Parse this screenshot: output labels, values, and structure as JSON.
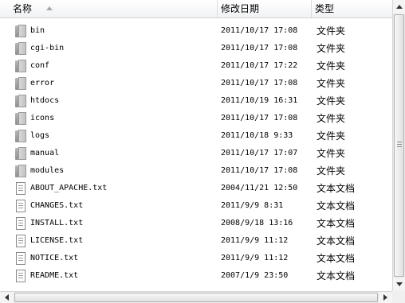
{
  "header": {
    "name_label": "名称",
    "date_label": "修改日期",
    "type_label": "类型"
  },
  "files": [
    {
      "name": "bin",
      "date": "2011/10/17 17:08",
      "type": "文件夹",
      "icon": "folder-icon"
    },
    {
      "name": "cgi-bin",
      "date": "2011/10/17 17:08",
      "type": "文件夹",
      "icon": "folder-icon"
    },
    {
      "name": "conf",
      "date": "2011/10/17 17:22",
      "type": "文件夹",
      "icon": "folder-icon"
    },
    {
      "name": "error",
      "date": "2011/10/17 17:08",
      "type": "文件夹",
      "icon": "folder-icon"
    },
    {
      "name": "htdocs",
      "date": "2011/10/19 16:31",
      "type": "文件夹",
      "icon": "folder-icon"
    },
    {
      "name": "icons",
      "date": "2011/10/17 17:08",
      "type": "文件夹",
      "icon": "folder-icon"
    },
    {
      "name": "logs",
      "date": "2011/10/18 9:33",
      "type": "文件夹",
      "icon": "folder-icon"
    },
    {
      "name": "manual",
      "date": "2011/10/17 17:07",
      "type": "文件夹",
      "icon": "folder-icon"
    },
    {
      "name": "modules",
      "date": "2011/10/17 17:08",
      "type": "文件夹",
      "icon": "folder-icon"
    },
    {
      "name": "ABOUT_APACHE.txt",
      "date": "2004/11/21 12:50",
      "type": "文本文档",
      "icon": "text-file-icon"
    },
    {
      "name": "CHANGES.txt",
      "date": "2011/9/9 8:31",
      "type": "文本文档",
      "icon": "text-file-icon"
    },
    {
      "name": "INSTALL.txt",
      "date": "2008/9/18 13:16",
      "type": "文本文档",
      "icon": "text-file-icon"
    },
    {
      "name": "LICENSE.txt",
      "date": "2011/9/9 11:12",
      "type": "文本文档",
      "icon": "text-file-icon"
    },
    {
      "name": "NOTICE.txt",
      "date": "2011/9/9 11:12",
      "type": "文本文档",
      "icon": "text-file-icon"
    },
    {
      "name": "README.txt",
      "date": "2007/1/9 23:50",
      "type": "文本文档",
      "icon": "text-file-icon"
    }
  ],
  "colors": {
    "header_bg": "#f1f2f4",
    "scrollbar_bg": "#eaeaea"
  }
}
